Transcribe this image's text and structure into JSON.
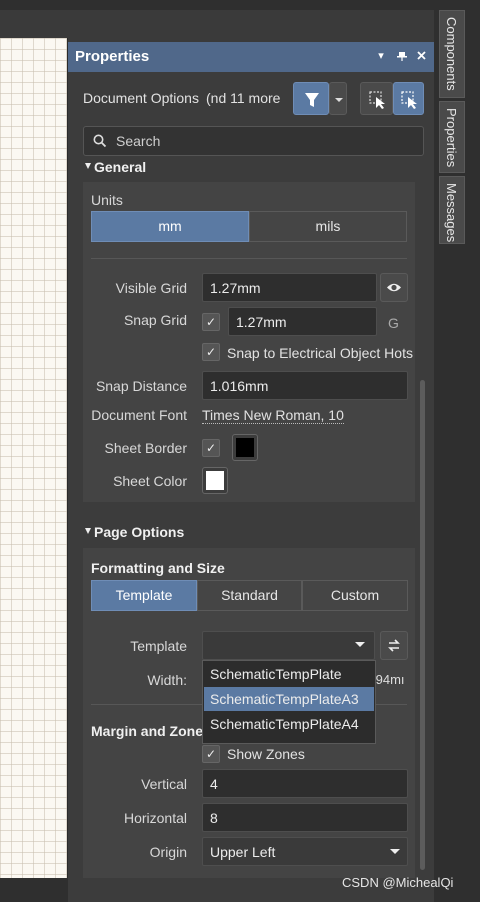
{
  "panel": {
    "title": "Properties",
    "title_buttons": [
      "▾",
      "ᵖ",
      "×"
    ]
  },
  "side_tabs": [
    "Components",
    "Properties",
    "Messages"
  ],
  "header": {
    "doc_label": "Document Options",
    "doc_more": "nd 11 more)"
  },
  "search": {
    "placeholder": "Search"
  },
  "general": {
    "title": "General",
    "units_label": "Units",
    "units": [
      {
        "label": "mm",
        "active": true
      },
      {
        "label": "mils",
        "active": false
      }
    ],
    "visible_grid_label": "Visible Grid",
    "visible_grid_value": "1.27mm",
    "snap_grid_label": "Snap Grid",
    "snap_grid_checked": true,
    "snap_grid_value": "1.27mm",
    "snap_grid_key": "G",
    "snap_electrical_label": "Snap to Electrical Object Hots",
    "snap_electrical_checked": true,
    "snap_distance_label": "Snap Distance",
    "snap_distance_value": "1.016mm",
    "document_font_label": "Document Font",
    "document_font_value": "Times New Roman, 10",
    "sheet_border_label": "Sheet Border",
    "sheet_border_checked": true,
    "sheet_border_color": "#000000",
    "sheet_color_label": "Sheet Color",
    "sheet_color": "#ffffff"
  },
  "page_options": {
    "title": "Page Options",
    "formatting_title": "Formatting and Size",
    "modes": [
      {
        "label": "Template",
        "active": true
      },
      {
        "label": "Standard",
        "active": false
      },
      {
        "label": "Custom",
        "active": false
      }
    ],
    "template_label": "Template",
    "template_value": "",
    "template_options": [
      "SchematicTempPlate",
      "SchematicTempPlateA3",
      "SchematicTempPlateA4"
    ],
    "highlighted_option": 1,
    "width_label": "Width:",
    "width_value_partial": ".94mı",
    "margin_title": "Margin and Zone",
    "show_zones_label": "Show Zones",
    "show_zones_checked": true,
    "vertical_label": "Vertical",
    "vertical_value": "4",
    "horizontal_label": "Horizontal",
    "horizontal_value": "8",
    "origin_label": "Origin",
    "origin_value": "Upper Left"
  },
  "watermark": "CSDN @MichealQi",
  "colors": {
    "accent": "#5b7aa3",
    "titlebar": "#50688a",
    "panel_bg": "#3c3c3c",
    "field_bg": "#2e2e2e"
  }
}
